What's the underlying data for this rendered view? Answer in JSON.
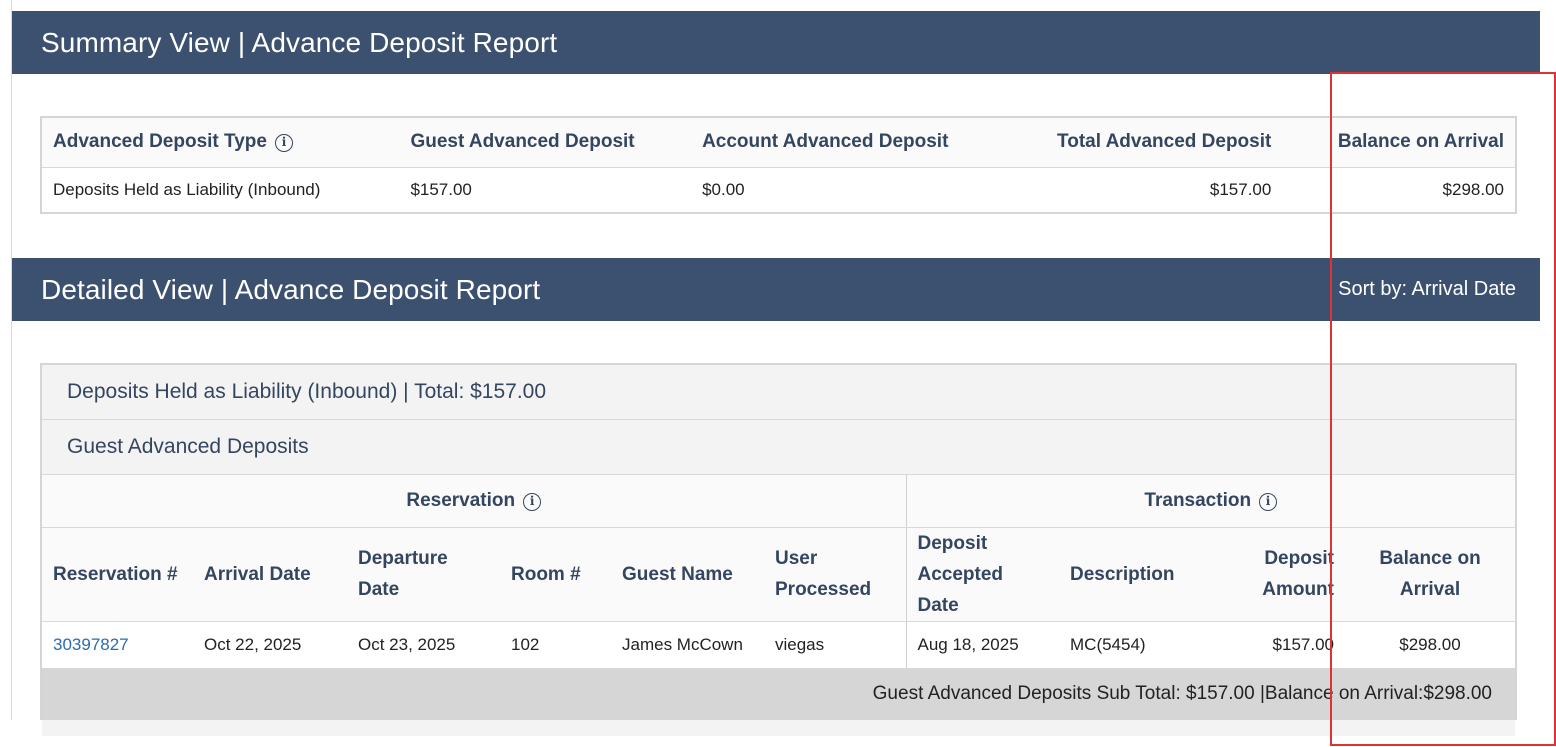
{
  "summary": {
    "title": "Summary View | Advance Deposit Report",
    "columns": {
      "type": "Advanced Deposit Type",
      "guest": "Guest Advanced Deposit",
      "account": "Account Advanced Deposit",
      "total": "Total Advanced Deposit",
      "balance": "Balance on Arrival"
    },
    "row": {
      "type": "Deposits Held as Liability (Inbound)",
      "guest": "$157.00",
      "account": "$0.00",
      "total": "$157.00",
      "balance": "$298.00"
    }
  },
  "detail": {
    "title": "Detailed View | Advance Deposit Report",
    "sort": "Sort by: Arrival Date",
    "group_title": "Deposits Held as Liability (Inbound) | Total: $157.00",
    "subgroup_title": "Guest Advanced Deposits",
    "header_groups": {
      "reservation": "Reservation",
      "transaction": "Transaction"
    },
    "columns": {
      "reservation_no": "Reservation #",
      "arrival": "Arrival Date",
      "departure": "Departure Date",
      "room": "Room #",
      "guest_name": "Guest Name",
      "user": "User Processed",
      "deposit_date_1": "Deposit",
      "deposit_date_2": "Accepted Date",
      "description": "Description",
      "amount_1": "Deposit",
      "amount_2": "Amount",
      "balance_1": "Balance on",
      "balance_2": "Arrival"
    },
    "rows": [
      {
        "reservation_no": "30397827",
        "arrival": "Oct 22, 2025",
        "departure": "Oct 23, 2025",
        "room": "102",
        "guest_name": "James McCown",
        "user": "viegas",
        "deposit_date": "Aug 18, 2025",
        "description": "MC(5454)",
        "amount": "$157.00",
        "balance": "$298.00"
      }
    ],
    "subtotal": "Guest Advanced Deposits Sub Total: $157.00 |Balance on Arrival:$298.00"
  },
  "icons": {
    "info": "info-icon"
  },
  "colors": {
    "band": "#3c5170",
    "link": "#2b6cb0",
    "highlight": "#dd3333"
  }
}
